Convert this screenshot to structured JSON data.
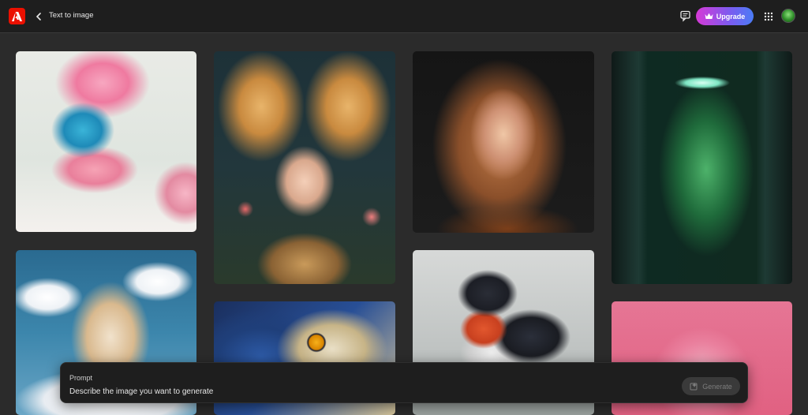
{
  "header": {
    "title": "Text to image",
    "upgrade_label": "Upgrade",
    "logo_icon": "adobe-icon",
    "back_icon": "chevron-left-icon",
    "feedback_icon": "feedback-icon",
    "apps_icon": "app-grid-icon",
    "upgrade_icon": "crown-icon"
  },
  "gallery": {
    "items": [
      {
        "subject": "bird-with-flowers"
      },
      {
        "subject": "fairy-girl"
      },
      {
        "subject": "woman-portrait"
      },
      {
        "subject": "fridge-terrarium"
      },
      {
        "subject": "paper-castle"
      },
      {
        "subject": "owl"
      },
      {
        "subject": "robin-bird"
      },
      {
        "subject": "snow-globe-castle"
      }
    ]
  },
  "prompt": {
    "label": "Prompt",
    "placeholder": "Describe the image you want to generate",
    "value": "",
    "generate_label": "Generate",
    "generate_icon": "generate-icon"
  },
  "colors": {
    "topbar": "#1e1e1e",
    "background": "#2b2b2b",
    "adobe_red": "#eb1000",
    "upgrade_gradient_start": "#d63ad6",
    "upgrade_gradient_end": "#4a7cf5"
  }
}
